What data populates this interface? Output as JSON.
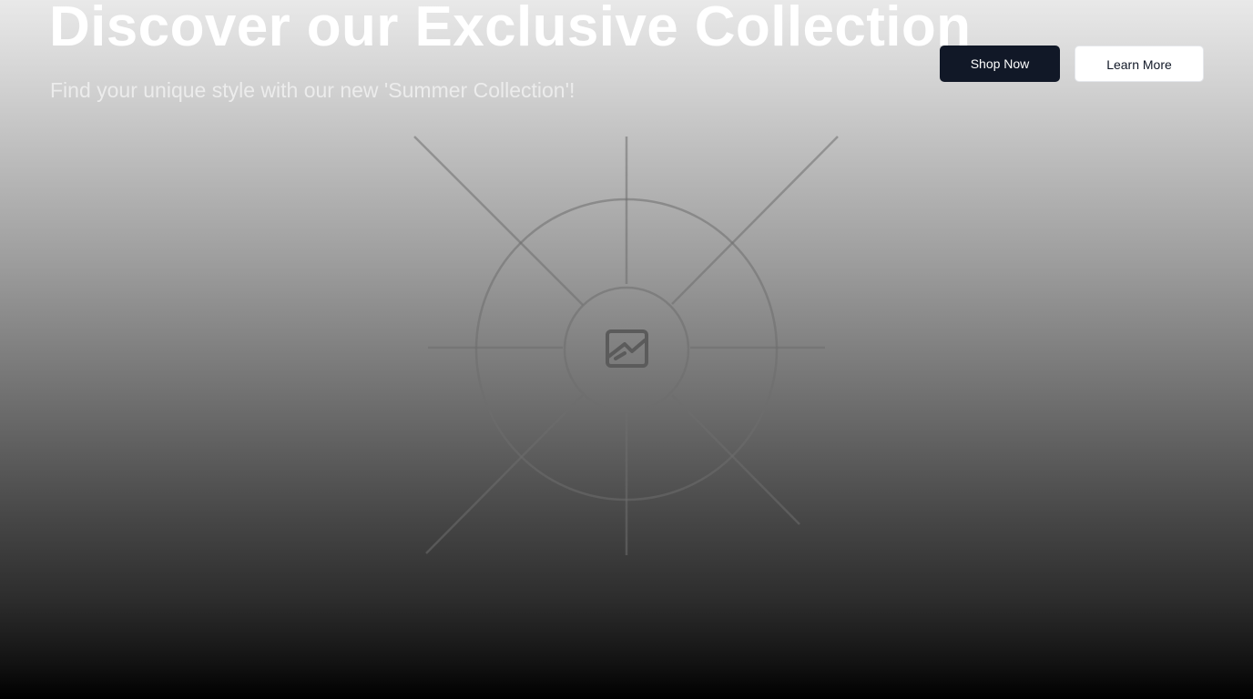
{
  "hero": {
    "title": "Discover our Exclusive Collection",
    "subtitle": "Find your unique style with our new 'Summer Collection'!",
    "primary_button": "Shop Now",
    "secondary_button": "Learn More",
    "placeholder_icon": "image-icon"
  },
  "colors": {
    "primary_button_bg": "#111827",
    "secondary_button_bg": "#ffffff",
    "title_text": "#ffffff"
  }
}
